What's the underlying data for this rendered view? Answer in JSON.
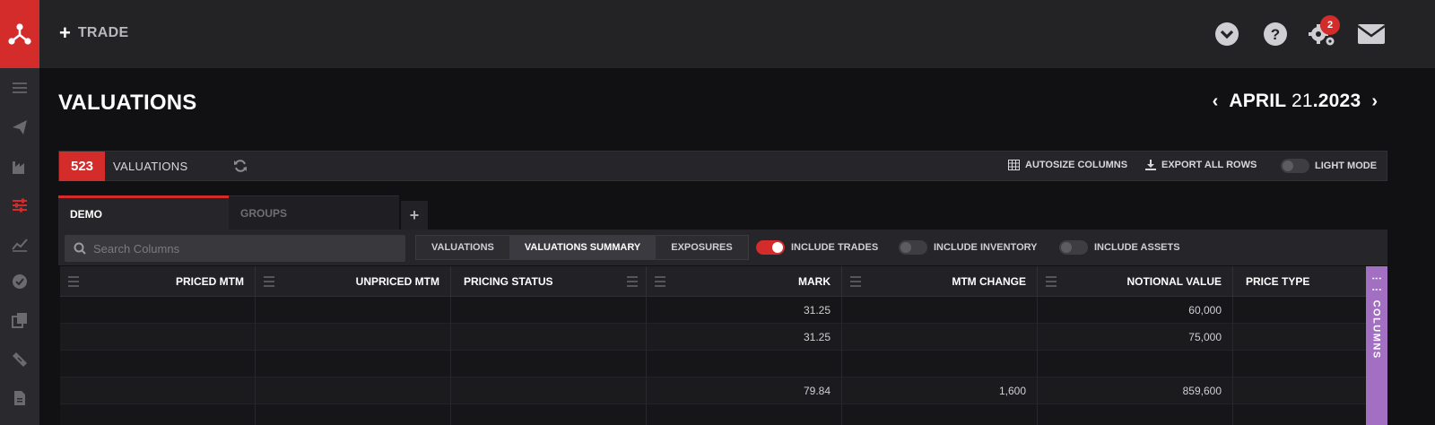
{
  "header": {
    "trade_label": "TRADE",
    "notification_count": "2"
  },
  "page": {
    "title": "VALUATIONS",
    "date_month": "APRIL",
    "date_day": "21",
    "date_year": ".2023"
  },
  "toolbar": {
    "count": "523",
    "label": "VALUATIONS",
    "autosize_label": "AUTOSIZE COLUMNS",
    "export_label": "EXPORT ALL ROWS",
    "light_mode_label": "LIGHT MODE",
    "light_mode_on": false
  },
  "tabs": [
    {
      "label": "DEMO",
      "active": true
    },
    {
      "label": "GROUPS",
      "active": false
    }
  ],
  "filter": {
    "search_placeholder": "Search Columns",
    "views": [
      {
        "label": "VALUATIONS",
        "active": false
      },
      {
        "label": "VALUATIONS SUMMARY",
        "active": true
      },
      {
        "label": "EXPOSURES",
        "active": false
      }
    ],
    "toggles": [
      {
        "label": "INCLUDE TRADES",
        "on": true
      },
      {
        "label": "INCLUDE INVENTORY",
        "on": false
      },
      {
        "label": "INCLUDE ASSETS",
        "on": false
      }
    ]
  },
  "grid": {
    "columns": [
      "PRICED MTM",
      "UNPRICED MTM",
      "PRICING STATUS",
      "MARK",
      "MTM CHANGE",
      "NOTIONAL VALUE",
      "PRICE TYPE"
    ],
    "rows": [
      [
        "",
        "",
        "",
        "31.25",
        "",
        "60,000",
        ""
      ],
      [
        "",
        "",
        "",
        "31.25",
        "",
        "75,000",
        ""
      ],
      [
        "",
        "",
        "",
        "",
        "",
        "",
        ""
      ],
      [
        "",
        "",
        "",
        "79.84",
        "1,600",
        "859,600",
        ""
      ],
      [
        "",
        "",
        "",
        "",
        "",
        "",
        ""
      ]
    ],
    "side_panel_label": "COLUMNS"
  },
  "colors": {
    "accent": "#d42b2b",
    "columns_panel": "#a36fc2"
  }
}
